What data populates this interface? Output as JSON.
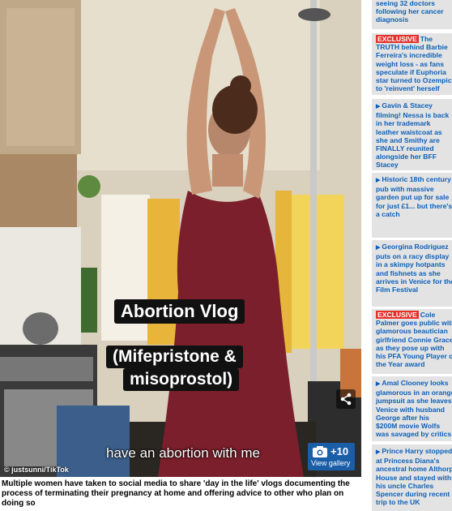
{
  "image": {
    "overlay_title": "Abortion Vlog",
    "overlay_drug_line1": "(Mifepristone &",
    "overlay_drug_line2": "misoprostol)",
    "subtitle": "have an abortion with me",
    "credit": "© justsunni/TikTok",
    "gallery_count": "+10",
    "gallery_label": "View gallery"
  },
  "article_caption": "Multiple women have taken to social media to share 'day in the life' vlogs documenting the process of terminating their pregnancy at home and offering advice to other who plan on doing so",
  "sidebar": {
    "exclusive_badge": "EXCLUSIVE",
    "items": [
      {
        "lines": [
          "seeing 32 doctors",
          "following her cancer",
          "diagnosis"
        ]
      },
      {
        "lines": [
          "The",
          "TRUTH behind Barbie",
          "Ferreira's incredible",
          "weight loss - as fans",
          "speculate if Euphoria",
          "star turned to Ozempic",
          "to 'reinvent' herself"
        ]
      },
      {
        "lines": [
          "Gavin & Stacey",
          "filming! Nessa is back",
          "in her trademark",
          "leather waistcoat as",
          "she and Smithy are",
          "FINALLY reunited",
          "alongside her BFF",
          "Stacey"
        ]
      },
      {
        "lines": [
          "Historic 18th century",
          "pub with massive",
          "garden put up for sale",
          "for just £1... but there's",
          "a catch"
        ]
      },
      {
        "lines": [
          "Georgina Rodriguez",
          "puts on a racy display",
          "in a skimpy hotpants",
          "and fishnets as she",
          "arrives in Venice for the",
          "Film Festival"
        ]
      },
      {
        "lines": [
          "Cole",
          "Palmer goes public with",
          "glamorous beautician",
          "girlfriend Connie Grace",
          "as they pose up with",
          "his PFA Young Player of",
          "the Year award"
        ]
      },
      {
        "lines": [
          "Amal Clooney looks",
          "glamorous in an orange",
          "jumpsuit as she leaves",
          "Venice with husband",
          "George after his",
          "$200M movie Wolfs",
          "was savaged by critics"
        ]
      },
      {
        "lines": [
          "Prince Harry stopped",
          "at Princess Diana's",
          "ancestral home Althorp",
          "House and stayed with",
          "his uncle Charles",
          "Spencer during recent",
          "trip to the UK"
        ]
      }
    ]
  },
  "colors": {
    "link": "#0c5fb8",
    "exclusive": "#e4322b",
    "gallery": "#1a5ea8",
    "sidebar_bg": "#e3e3e3"
  }
}
